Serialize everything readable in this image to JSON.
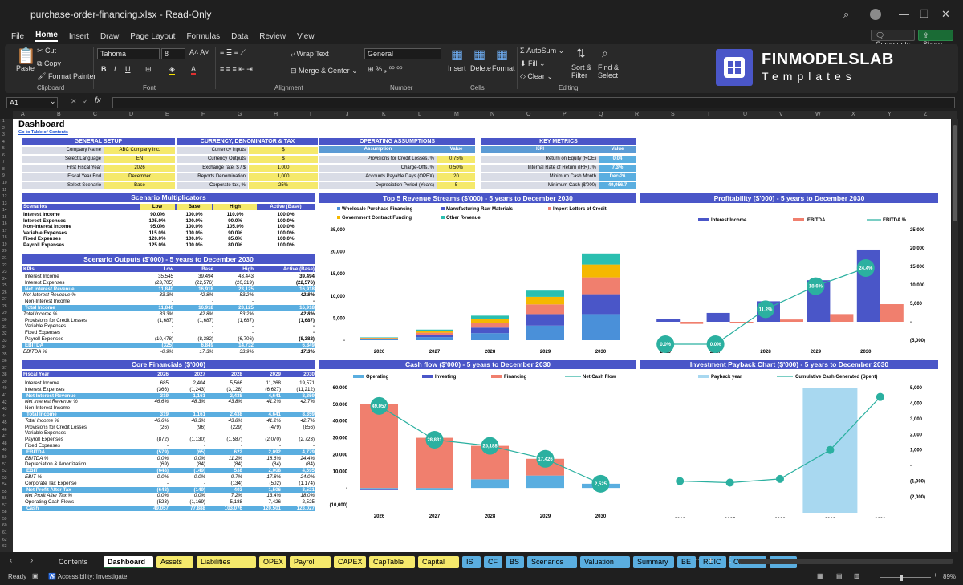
{
  "window": {
    "filename": "purchase-order-financing.xlsx - Read-Only",
    "mode": ""
  },
  "menu": {
    "items": [
      "File",
      "Home",
      "Insert",
      "Draw",
      "Page Layout",
      "Formulas",
      "Data",
      "Review",
      "View"
    ],
    "comments": "Comments",
    "share": "Share"
  },
  "ribbon": {
    "paste": "Paste",
    "cut": "Cut",
    "copy": "Copy",
    "format_painter": "Format Painter",
    "clipboard": "Clipboard",
    "font_name": "Tahoma",
    "font_size": "8",
    "font_label": "Font",
    "wrap_text": "Wrap Text",
    "merge_center": "Merge & Center",
    "alignment": "Alignment",
    "number_format": "General",
    "number": "Number",
    "insert": "Insert",
    "delete": "Delete",
    "format": "Format",
    "cells": "Cells",
    "autosum": "AutoSum",
    "fill": "Fill",
    "clear": "Clear",
    "sort_filter": "Sort & Filter",
    "find_select": "Find & Select",
    "editing": "Editing",
    "logo_main": "FINMODELSLAB",
    "logo_sub": "Templates"
  },
  "formula_bar": {
    "cell": "A1",
    "fx": "fx"
  },
  "columns": [
    "A",
    "B",
    "C",
    "D",
    "E",
    "F",
    "G",
    "H",
    "I",
    "J",
    "K",
    "L",
    "M",
    "N",
    "O",
    "P",
    "Q",
    "R",
    "S",
    "T",
    "U",
    "V",
    "W",
    "X",
    "Y",
    "Z"
  ],
  "sheet": {
    "title": "Dashboard",
    "toc_link": "Go to Table of Contents",
    "general_setup": {
      "header": "GENERAL SETUP",
      "rows": [
        [
          "Company Name",
          "ABC Company Inc."
        ],
        [
          "Select Language",
          "EN"
        ],
        [
          "First Fiscal Year",
          "2026"
        ],
        [
          "Fiscal Year End",
          "December"
        ],
        [
          "Select Scenario",
          "Base"
        ]
      ]
    },
    "currency": {
      "header": "CURRENCY, DENOMINATOR & TAX",
      "rows": [
        [
          "Currency Inputs",
          "$"
        ],
        [
          "Currency Outputs",
          "$"
        ],
        [
          "Exchange rate, $ / $",
          "1.000"
        ],
        [
          "Reports Denomination",
          "1,000"
        ],
        [
          "Corporate tax, %",
          "25%"
        ]
      ]
    },
    "operating": {
      "header": "OPERATING ASSUMPTIONS",
      "col1": "Assumption",
      "col2": "Value",
      "rows": [
        [
          "Provisions for Credit Losses, %",
          "0.75%"
        ],
        [
          "Charge-Offs, %",
          "0.50%"
        ],
        [
          "Accounts Payable Days (OPEX)",
          "20"
        ],
        [
          "Depreciation Period (Years)",
          "5"
        ]
      ]
    },
    "key_metrics": {
      "header": "KEY METRICS",
      "col1": "KPI",
      "col2": "Value",
      "rows": [
        [
          "Return on Equity (ROE)",
          "0.04"
        ],
        [
          "Internal Rate of Return (IRR), %",
          "7.3%"
        ],
        [
          "Minimum Cash Month",
          "Dec-26"
        ],
        [
          "Minimum Cash ($'000)",
          "49,056.7"
        ]
      ]
    },
    "multipliers": {
      "header": "Scenario Multiplicators",
      "cols": [
        "Scenarios",
        "Low",
        "Base",
        "High",
        "Active (Base)"
      ],
      "rows": [
        [
          "Interest Income",
          "90.0%",
          "100.0%",
          "110.0%",
          "100.0%"
        ],
        [
          "Interest Expenses",
          "105.0%",
          "100.0%",
          "90.0%",
          "100.0%"
        ],
        [
          "Non-Interest Income",
          "95.0%",
          "100.0%",
          "105.0%",
          "100.0%"
        ],
        [
          "Variable Expenses",
          "115.0%",
          "100.0%",
          "90.0%",
          "100.0%"
        ],
        [
          "Fixed Expenses",
          "120.0%",
          "100.0%",
          "85.0%",
          "100.0%"
        ],
        [
          "Payroll Expenses",
          "125.0%",
          "100.0%",
          "80.0%",
          "100.0%"
        ]
      ]
    },
    "scenario_outputs": {
      "header": "Scenario Outputs ($'000) - 5 years to December 2030",
      "cols": [
        "KPIs",
        "Low",
        "Base",
        "High",
        "Active (Base)"
      ],
      "rows": [
        [
          "Interest Income",
          "35,545",
          "39,494",
          "43,443",
          "39,494",
          "n"
        ],
        [
          "Interest Expenses",
          "(23,705)",
          "(22,576)",
          "(20,319)",
          "(22,576)",
          "n"
        ],
        [
          "Net Interest Revenue",
          "11,840",
          "16,918",
          "23,125",
          "16,918",
          "hl"
        ],
        [
          "Net Interest Revenue %",
          "33.3%",
          "42.8%",
          "53.2%",
          "42.8%",
          "i"
        ],
        [
          "Non-Interest Income",
          "-",
          "-",
          "-",
          "-",
          "n"
        ],
        [
          "Total Income",
          "11,840",
          "16,918",
          "23,125",
          "16,918",
          "hl"
        ],
        [
          "Total Income %",
          "33.3%",
          "42.8%",
          "53.2%",
          "42.8%",
          "i"
        ],
        [
          "Provisions for Credit Losses",
          "(1,687)",
          "(1,687)",
          "(1,687)",
          "(1,687)",
          "n"
        ],
        [
          "Variable Expenses",
          "-",
          "-",
          "-",
          "-",
          "n"
        ],
        [
          "Fixed Expenses",
          "-",
          "-",
          "-",
          "-",
          "n"
        ],
        [
          "Payroll Expenses",
          "(10,478)",
          "(8,382)",
          "(6,706)",
          "(8,382)",
          "n"
        ],
        [
          "EBITDA",
          "(325)",
          "6,849",
          "14,732",
          "6,849",
          "hl"
        ],
        [
          "EBITDA %",
          "-0.9%",
          "17.3%",
          "33.9%",
          "17.3%",
          "i"
        ]
      ]
    },
    "core_financials": {
      "header": "Core Financials ($'000)",
      "cols": [
        "Fiscal Year",
        "2026",
        "2027",
        "2028",
        "2029",
        "2030"
      ],
      "rows": [
        [
          "Interest Income",
          "685",
          "2,404",
          "5,566",
          "11,268",
          "19,571",
          "n"
        ],
        [
          "Interest Expenses",
          "(366)",
          "(1,243)",
          "(3,128)",
          "(6,627)",
          "(11,212)",
          "n"
        ],
        [
          "Net Interest Revenue",
          "319",
          "1,161",
          "2,438",
          "4,641",
          "8,359",
          "hl"
        ],
        [
          "Net Interest Revenue %",
          "46.6%",
          "48.3%",
          "43.8%",
          "41.2%",
          "42.7%",
          "i"
        ],
        [
          "Non-Interest Income",
          "-",
          "-",
          "-",
          "-",
          "-",
          "n"
        ],
        [
          "Total Income",
          "319",
          "1,161",
          "2,438",
          "4,641",
          "8,359",
          "hl"
        ],
        [
          "Total Income %",
          "46.6%",
          "48.3%",
          "43.8%",
          "41.2%",
          "42.7%",
          "i"
        ],
        [
          "Provisions for Credit Losses",
          "(26)",
          "(96)",
          "(229)",
          "(479)",
          "(856)",
          "n"
        ],
        [
          "Variable Expenses",
          "-",
          "-",
          "-",
          "-",
          "-",
          "n"
        ],
        [
          "Payroll Expenses",
          "(872)",
          "(1,130)",
          "(1,587)",
          "(2,070)",
          "(2,723)",
          "n"
        ],
        [
          "Fixed Expenses",
          "-",
          "-",
          "-",
          "-",
          "-",
          "n"
        ],
        [
          "EBITDA",
          "(579)",
          "(65)",
          "622",
          "2,092",
          "4,779",
          "hl"
        ],
        [
          "EBITDA %",
          "0.0%",
          "0.0%",
          "11.2%",
          "18.6%",
          "24.4%",
          "i"
        ],
        [
          "Depreciation & Amortization",
          "(69)",
          "(84)",
          "(84)",
          "(84)",
          "(84)",
          "n"
        ],
        [
          "EBIT",
          "(648)",
          "(149)",
          "538",
          "2,008",
          "4,695",
          "hl"
        ],
        [
          "EBIT %",
          "0.0%",
          "0.0%",
          "9.7%",
          "17.8%",
          "24.0%",
          "i"
        ],
        [
          "Corporate Tax Expense",
          "-",
          "-",
          "(134)",
          "(502)",
          "(1,174)",
          "n"
        ],
        [
          "Net Profit After Tax",
          "(648)",
          "(149)",
          "403",
          "1,506",
          "3,521",
          "hl"
        ],
        [
          "Net Profit After Tax %",
          "0.0%",
          "0.0%",
          "7.2%",
          "13.4%",
          "18.0%",
          "i"
        ],
        [
          "Operating Cash Flows",
          "(523)",
          "(1,169)",
          "5,188",
          "7,426",
          "2,525",
          "n"
        ],
        [
          "Cash",
          "49,057",
          "77,888",
          "103,076",
          "120,501",
          "123,027",
          "hl"
        ]
      ]
    }
  },
  "chart_data": [
    {
      "type": "bar",
      "title": "Top 5 Revenue Streams ($'000) - 5 years to December 2030",
      "categories": [
        "2026",
        "2027",
        "2028",
        "2029",
        "2030"
      ],
      "series": [
        {
          "name": "Wholesale Purchase Financing",
          "values": [
            200,
            700,
            1600,
            3300,
            5900
          ],
          "color": "#4a90d9"
        },
        {
          "name": "Manufacturing Raw Materials",
          "values": [
            150,
            550,
            1250,
            2600,
            4500
          ],
          "color": "#4a56c8"
        },
        {
          "name": "Import Letters of Credit",
          "values": [
            120,
            450,
            1100,
            2200,
            3800
          ],
          "color": "#f07f6e"
        },
        {
          "name": "Government Contract Funding",
          "values": [
            80,
            350,
            900,
            1700,
            2900
          ],
          "color": "#f5b800"
        },
        {
          "name": "Other Revenue",
          "values": [
            100,
            350,
            700,
            1400,
            2500
          ],
          "color": "#2bbfb0"
        }
      ],
      "ylim": [
        0,
        25000
      ],
      "yticks": [
        "-",
        "5,000",
        "10,000",
        "15,000",
        "20,000",
        "25,000"
      ]
    },
    {
      "type": "bar",
      "title": "Profitability ($'000) - 5 years to December 2030",
      "categories": [
        "2026",
        "2027",
        "2028",
        "2029",
        "2030"
      ],
      "series": [
        {
          "name": "Interest Income",
          "values": [
            685,
            2404,
            5566,
            11268,
            19571
          ],
          "color": "#4a56c8"
        },
        {
          "name": "EBITDA",
          "values": [
            -579,
            -65,
            622,
            2092,
            4779
          ],
          "color": "#f07f6e"
        }
      ],
      "line": {
        "name": "EBITDA %",
        "values": [
          0.0,
          0.0,
          11.2,
          18.6,
          24.4
        ],
        "labels": [
          "0.0%",
          "0.0%",
          "11.2%",
          "18.6%",
          "24.4%"
        ],
        "color": "#2bb0a0"
      },
      "ylim": [
        -5000,
        25000
      ],
      "yticks": [
        "(5,000)",
        "-",
        "5,000",
        "10,000",
        "15,000",
        "20,000",
        "25,000"
      ]
    },
    {
      "type": "bar",
      "title": "Cash flow ($'000) - 5 years to December 2030",
      "categories": [
        "2026",
        "2027",
        "2028",
        "2029",
        "2030"
      ],
      "series": [
        {
          "name": "Operating",
          "values": [
            -523,
            -1169,
            5188,
            7426,
            2525
          ],
          "color": "#5aaee0"
        },
        {
          "name": "Investing",
          "values": [
            -350,
            0,
            0,
            0,
            0
          ],
          "color": "#4a56c8"
        },
        {
          "name": "Financing",
          "values": [
            50000,
            30000,
            20000,
            10000,
            0
          ],
          "color": "#f07f6e"
        }
      ],
      "line": {
        "name": "Net Cash Flow",
        "values": [
          49057,
          28831,
          25188,
          17426,
          2525
        ],
        "labels": [
          "49,057",
          "28,831",
          "25,188",
          "17,426",
          "2,525"
        ],
        "color": "#2bb0a0"
      },
      "ylim": [
        -10000,
        60000
      ],
      "yticks": [
        "(10,000)",
        "-",
        "10,000",
        "20,000",
        "30,000",
        "40,000",
        "50,000",
        "60,000"
      ]
    },
    {
      "type": "line",
      "title": "Investment Payback Chart ($'000) - 5 years to December 2030",
      "categories": [
        "2026",
        "2027",
        "2028",
        "2029",
        "2030"
      ],
      "payback": {
        "name": "Payback year",
        "index": 3,
        "color": "#a8d8f0"
      },
      "series": [
        {
          "name": "Cumulative Cash Generated (Spent)",
          "values": [
            -1000,
            -1100,
            -860,
            1000,
            4400
          ],
          "color": "#2bb0a0"
        }
      ],
      "ylim": [
        -2000,
        5000
      ],
      "yticks": [
        "(2,000)",
        "(1,000)",
        "-",
        "1,000",
        "2,000",
        "3,000",
        "4,000",
        "5,000"
      ]
    }
  ],
  "tabs": [
    {
      "label": "Contents",
      "color": "#1f1f1f",
      "text": "#ddd"
    },
    {
      "label": "Dashboard",
      "color": "#ffffff",
      "text": "#000",
      "active": true
    },
    {
      "label": "Assets",
      "color": "#f5e96b"
    },
    {
      "label": "Liabilities",
      "color": "#f5e96b"
    },
    {
      "label": "OPEX",
      "color": "#f5e96b"
    },
    {
      "label": "Payroll",
      "color": "#f5e96b"
    },
    {
      "label": "CAPEX",
      "color": "#f5e96b"
    },
    {
      "label": "CapTable",
      "color": "#f5e96b"
    },
    {
      "label": "Capital",
      "color": "#f5e96b"
    },
    {
      "label": "IS",
      "color": "#5aaee0"
    },
    {
      "label": "CF",
      "color": "#5aaee0"
    },
    {
      "label": "BS",
      "color": "#5aaee0"
    },
    {
      "label": "Scenarios",
      "color": "#5aaee0"
    },
    {
      "label": "Valuation",
      "color": "#5aaee0"
    },
    {
      "label": "Summary",
      "color": "#5aaee0"
    },
    {
      "label": "BE",
      "color": "#5aaee0"
    },
    {
      "label": "ROIC",
      "color": "#5aaee0"
    },
    {
      "label": "Charts",
      "color": "#5aaee0"
    },
    {
      "label": "KPIs",
      "color": "#5aaee0"
    }
  ],
  "status": {
    "ready": "Ready",
    "accessibility": "Accessibility: Investigate",
    "zoom": "89%"
  }
}
